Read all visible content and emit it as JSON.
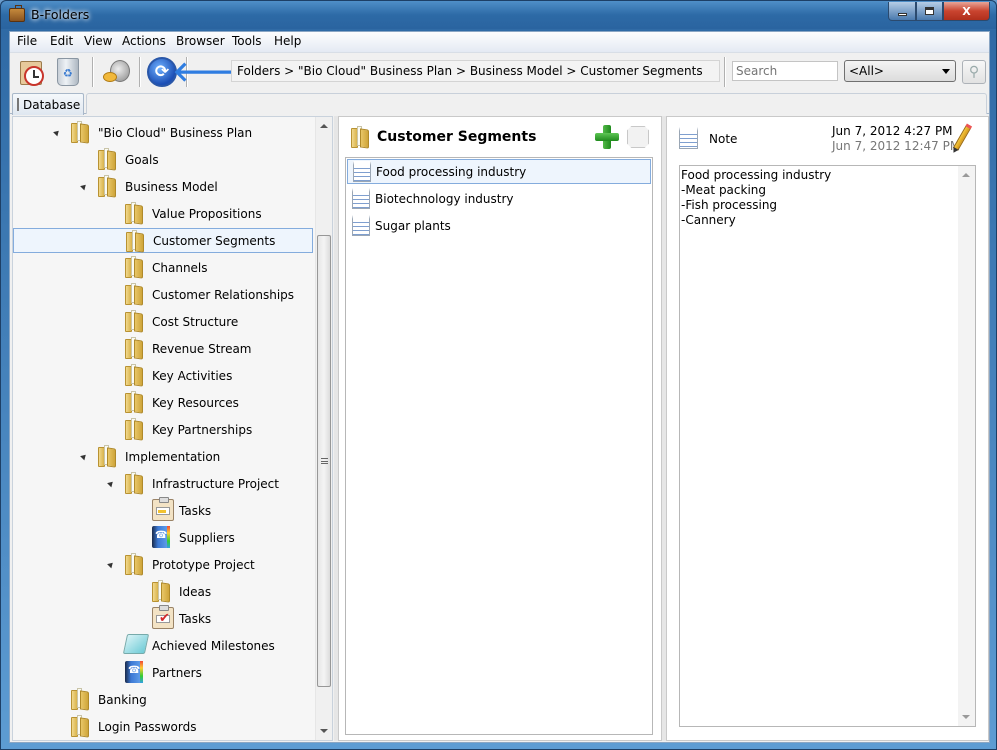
{
  "window": {
    "title": "B-Folders",
    "controls": {
      "minimize": "minimize",
      "maximize": "maximize",
      "close": "X"
    }
  },
  "menu": [
    "File",
    "Edit",
    "View",
    "Actions",
    "Browser",
    "Tools",
    "Help"
  ],
  "toolbar": {
    "buttons": [
      {
        "icon": "reminder-clock-icon",
        "name": "reminders"
      },
      {
        "icon": "recycle-bin-icon",
        "name": "recycle-bin"
      },
      {
        "icon": "lock-key-icon",
        "name": "lock"
      },
      {
        "icon": "sync-icon",
        "name": "synchronize"
      },
      {
        "icon": "back-arrow-icon",
        "name": "back"
      }
    ],
    "breadcrumb": "Folders > \"Bio Cloud\" Business Plan  > Business Model > Customer Segments",
    "search_placeholder": "Search",
    "filter_value": "<All>",
    "search_button_icon": "magnifier-icon"
  },
  "tabs": {
    "database_label": "Database"
  },
  "tree": {
    "items": [
      {
        "label": "\"Bio Cloud\" Business Plan",
        "icon": "folder",
        "level": 0,
        "expanded": true
      },
      {
        "label": "Goals",
        "icon": "folder",
        "level": 1
      },
      {
        "label": "Business Model",
        "icon": "folder",
        "level": 1,
        "expanded": true
      },
      {
        "label": "Value Propositions",
        "icon": "folder",
        "level": 2
      },
      {
        "label": "Customer Segments",
        "icon": "folder",
        "level": 2,
        "selected": true
      },
      {
        "label": "Channels",
        "icon": "folder",
        "level": 2
      },
      {
        "label": "Customer Relationships",
        "icon": "folder",
        "level": 2
      },
      {
        "label": "Cost Structure",
        "icon": "folder",
        "level": 2
      },
      {
        "label": "Revenue Stream",
        "icon": "folder",
        "level": 2
      },
      {
        "label": "Key Activities",
        "icon": "folder",
        "level": 2
      },
      {
        "label": "Key Resources",
        "icon": "folder",
        "level": 2
      },
      {
        "label": "Key Partnerships",
        "icon": "folder",
        "level": 2
      },
      {
        "label": "Implementation",
        "icon": "folder",
        "level": 1,
        "expanded": true
      },
      {
        "label": "Infrastructure Project",
        "icon": "folder",
        "level": 2,
        "expanded": true
      },
      {
        "label": "Tasks",
        "icon": "tasks",
        "level": 3
      },
      {
        "label": "Suppliers",
        "icon": "contacts",
        "level": 3
      },
      {
        "label": "Prototype Project",
        "icon": "folder",
        "level": 2,
        "expanded": true
      },
      {
        "label": "Ideas",
        "icon": "folder",
        "level": 3
      },
      {
        "label": "Tasks",
        "icon": "tasks-done",
        "level": 3
      },
      {
        "label": "Achieved Milestones",
        "icon": "notepad",
        "level": 2
      },
      {
        "label": "Partners",
        "icon": "contacts",
        "level": 2
      },
      {
        "label": "Banking",
        "icon": "folder",
        "level": 0
      },
      {
        "label": "Login Passwords",
        "icon": "folder",
        "level": 0
      }
    ]
  },
  "list": {
    "title": "Customer Segments",
    "add_icon": "add-icon",
    "tag_icon": "tag-icon",
    "items": [
      {
        "label": "Food processing industry",
        "selected": true
      },
      {
        "label": "Biotechnology industry"
      },
      {
        "label": "Sugar plants"
      }
    ]
  },
  "detail": {
    "type_label": "Note",
    "modified": "Jun 7, 2012 4:27 PM",
    "created": "Jun 7, 2012 12:47 PM",
    "edit_icon": "pencil-icon",
    "body": "Food processing industry\n-Meat packing\n-Fish processing\n-Cannery"
  }
}
